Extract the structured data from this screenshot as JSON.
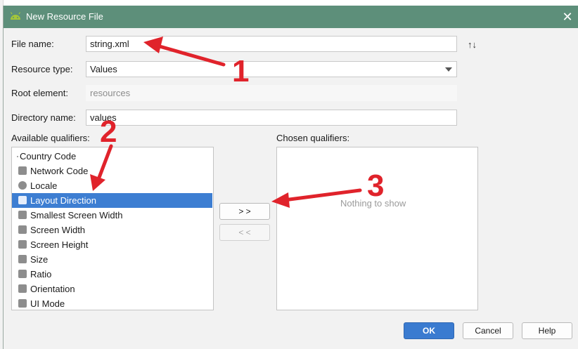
{
  "window": {
    "title": "New Resource File",
    "close_glyph": "✕",
    "icon": "android-icon"
  },
  "form": {
    "file_name_label": "File name:",
    "file_name_value": "string.xml",
    "resource_type_label": "Resource type:",
    "resource_type_value": "Values",
    "root_element_label": "Root element:",
    "root_element_value": "resources",
    "directory_name_label": "Directory name:",
    "directory_name_value": "values",
    "sort_glyph": "↑↓"
  },
  "qualifiers": {
    "available_label": "Available qualifiers:",
    "chosen_label": "Chosen qualifiers:",
    "items": [
      {
        "label": "Country Code",
        "icon": "dot-icon"
      },
      {
        "label": "Network Code",
        "icon": "network-icon"
      },
      {
        "label": "Locale",
        "icon": "globe-icon"
      },
      {
        "label": "Layout Direction",
        "icon": "layout-direction-icon"
      },
      {
        "label": "Smallest Screen Width",
        "icon": "smallest-width-icon"
      },
      {
        "label": "Screen Width",
        "icon": "screen-width-icon"
      },
      {
        "label": "Screen Height",
        "icon": "screen-height-icon"
      },
      {
        "label": "Size",
        "icon": "size-icon"
      },
      {
        "label": "Ratio",
        "icon": "ratio-icon"
      },
      {
        "label": "Orientation",
        "icon": "orientation-icon"
      },
      {
        "label": "UI Mode",
        "icon": "ui-mode-icon"
      }
    ],
    "selected_index": 3,
    "empty_message": "Nothing to show",
    "add_button": "> >",
    "remove_button": "< <"
  },
  "buttons": {
    "ok": "OK",
    "cancel": "Cancel",
    "help": "Help"
  },
  "annotations": [
    "1",
    "2",
    "3"
  ],
  "colors": {
    "titlebar": "#5d8f7a",
    "selection": "#3d7ed2",
    "primary": "#3a7bd0",
    "annotation": "#e0232b"
  }
}
